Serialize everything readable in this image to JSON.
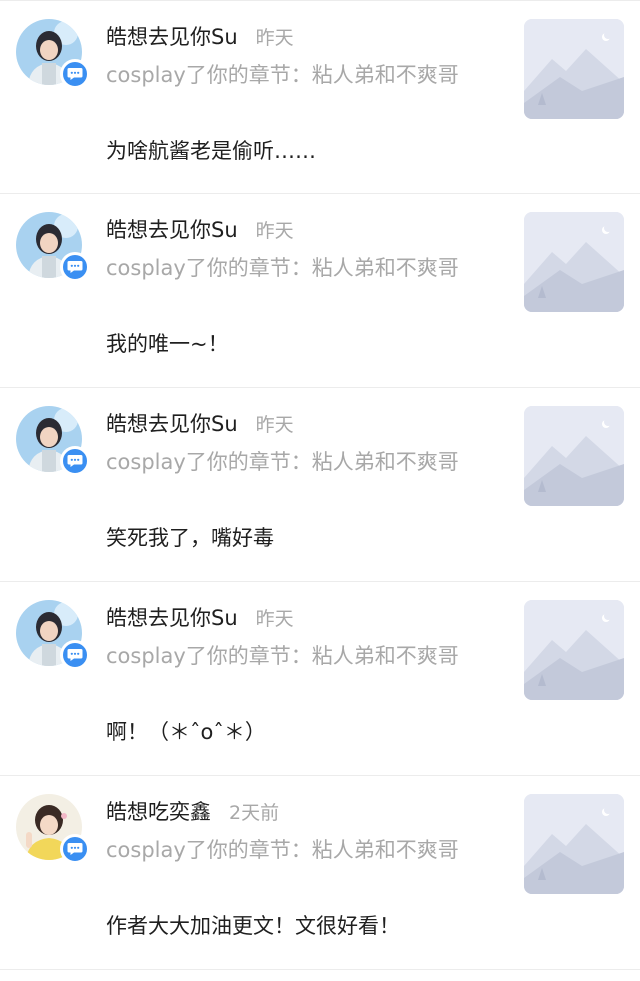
{
  "notifications": [
    {
      "user": "皓想去见你Su",
      "time": "昨天",
      "target": "cosplay了你的章节：粘人弟和不爽哥",
      "comment": "为啥航酱老是偷听……",
      "avatar": "avatar-blue-portrait"
    },
    {
      "user": "皓想去见你Su",
      "time": "昨天",
      "target": "cosplay了你的章节：粘人弟和不爽哥",
      "comment": "我的唯一~！",
      "avatar": "avatar-blue-portrait"
    },
    {
      "user": "皓想去见你Su",
      "time": "昨天",
      "target": "cosplay了你的章节：粘人弟和不爽哥",
      "comment": "笑死我了，嘴好毒",
      "avatar": "avatar-blue-portrait"
    },
    {
      "user": "皓想去见你Su",
      "time": "昨天",
      "target": "cosplay了你的章节：粘人弟和不爽哥",
      "comment": "啊！（＊ˆoˆ＊）",
      "avatar": "avatar-blue-portrait"
    },
    {
      "user": "皓想吃奕鑫",
      "time": "2天前",
      "target": "cosplay了你的章节：粘人弟和不爽哥",
      "comment": "作者大大加油更文！文很好看！",
      "avatar": "avatar-yellow-portrait"
    }
  ],
  "colors": {
    "accent": "#3a8ff2",
    "muted_text": "#a8a8a8",
    "primary_text": "#1f1f1f",
    "divider": "#ececec",
    "thumb_bg": "#e6e9f3"
  },
  "icons": {
    "badge": "comment-bubble-icon",
    "thumbnail": "mountain-placeholder-icon"
  }
}
